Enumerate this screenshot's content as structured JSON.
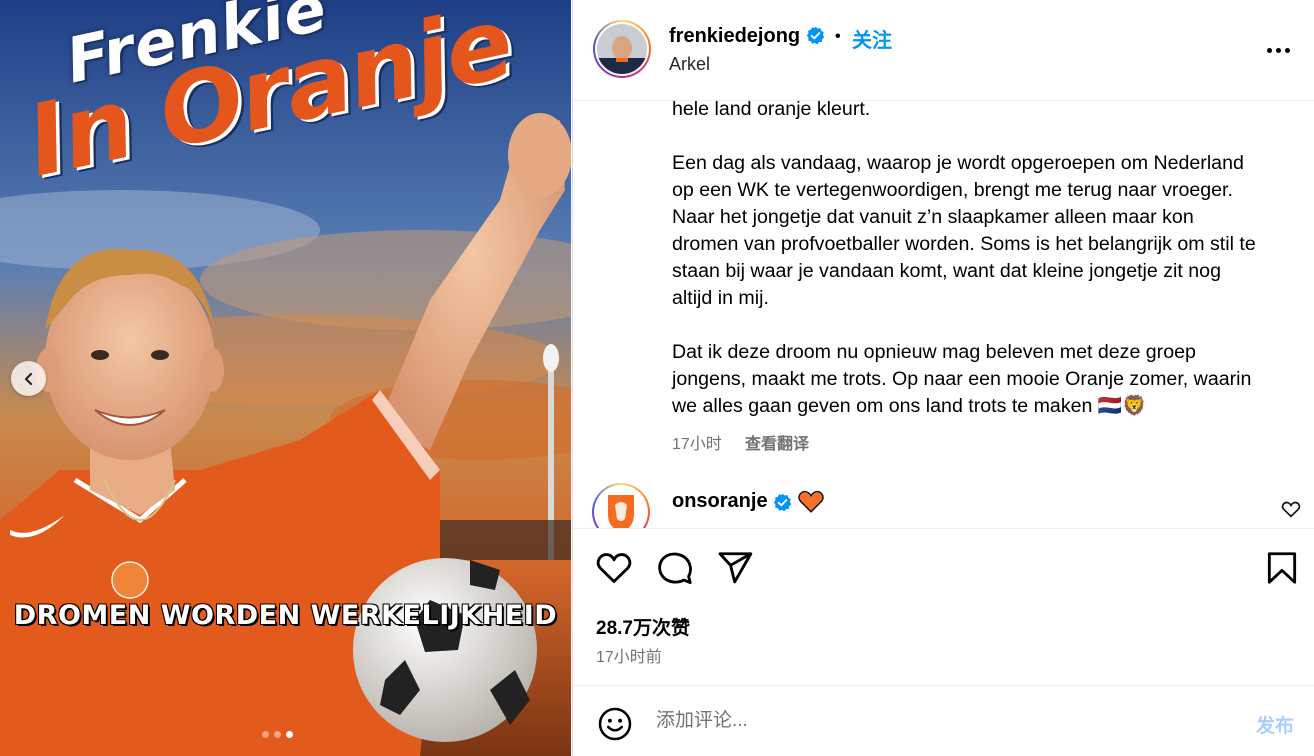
{
  "media": {
    "title_line1": "Frenkie",
    "title_line2": "In Oranje",
    "tagline": "DROMEN WORDEN WERKELIJKHEID",
    "carousel_total": 3,
    "carousel_active": 3,
    "prev_icon": "chevron-left-icon"
  },
  "post": {
    "author": "frenkiedejong",
    "verified": true,
    "follow_separator": "•",
    "follow_label": "关注",
    "location": "Arkel",
    "more_icon": "more-horizontal-icon"
  },
  "caption": {
    "paragraphs": [
      "hele land oranje kleurt.",
      "Een dag als vandaag, waarop je wordt opgeroepen om Nederland\nop een WK te vertegenwoordigen, brengt me terug naar vroeger.\nNaar het jongetje dat vanuit z’n slaapkamer alleen maar kon\ndromen van profvoetballer worden. Soms is het belangrijk om stil te\nstaan bij waar je vandaan komt, want dat kleine jongetje zit nog\naltijd in mij.",
      "Dat ik deze droom nu opnieuw mag beleven met deze groep\njongens, maakt me trots. Op naar een mooie Oranje zomer, waarin\nwe alles gaan geven om ons land trots te maken 🇳🇱🦁"
    ],
    "time_ago": "17小时",
    "translate_label": "查看翻译"
  },
  "comments": [
    {
      "username": "onsoranje",
      "verified": true,
      "reaction": "orange-heart"
    }
  ],
  "actions": {
    "like_icon": "heart-icon",
    "comment_icon": "comment-icon",
    "share_icon": "send-icon",
    "save_icon": "bookmark-icon"
  },
  "stats": {
    "likes": "28.7万次赞",
    "posted": "17小时前"
  },
  "comment_box": {
    "placeholder": "添加评论...",
    "post_label": "发布",
    "emoji_icon": "emoji-icon"
  },
  "colors": {
    "accent": "#0095f6",
    "post_disabled": "#a8cffa",
    "muted": "#737373",
    "orange": "#e4561c"
  }
}
